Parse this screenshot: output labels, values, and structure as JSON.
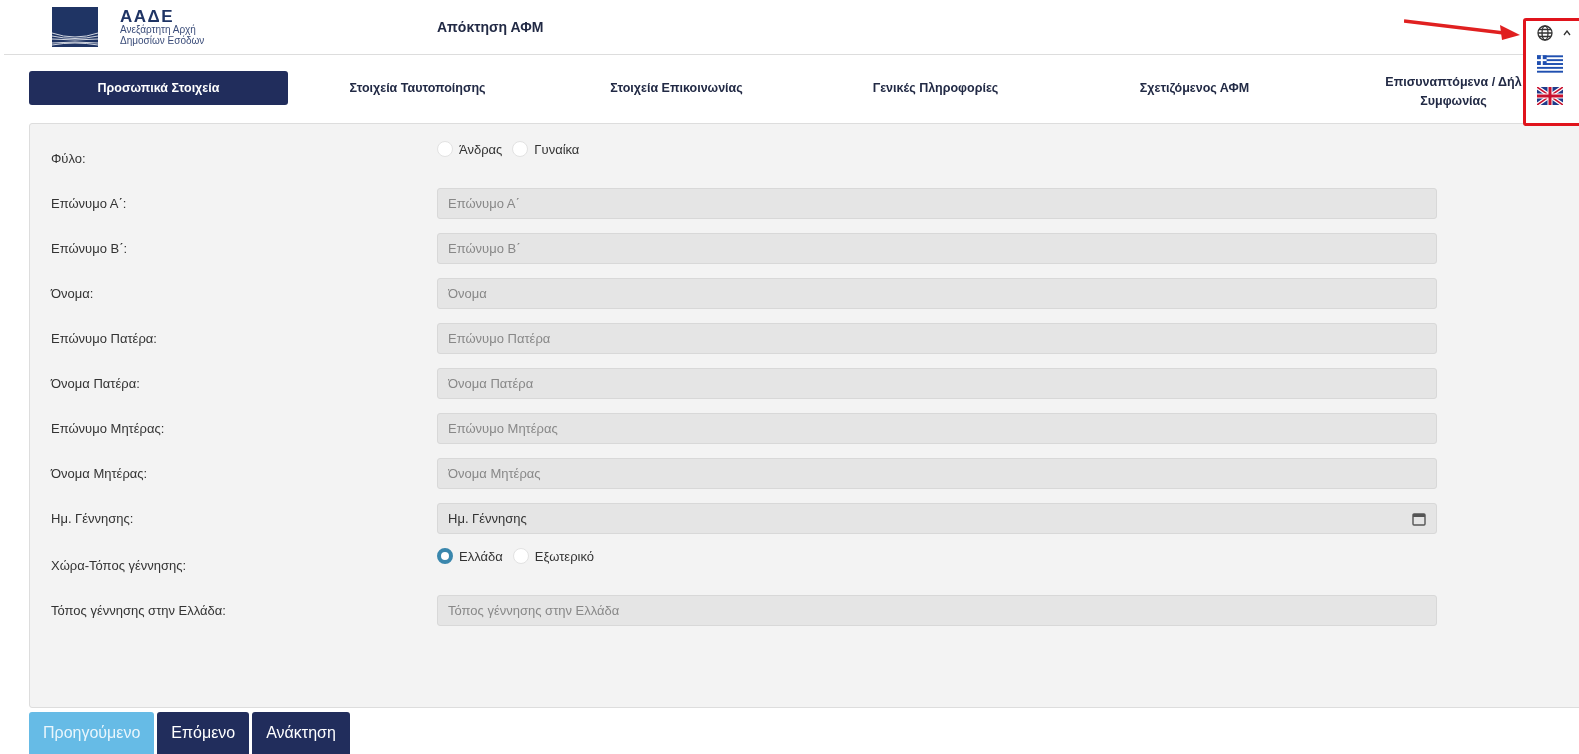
{
  "header": {
    "logo": {
      "acronym": "ΑΑΔΕ",
      "subtitle_line_1": "Ανεξάρτητη Αρχή",
      "subtitle_line_2": "Δημοσίων Εσόδων"
    },
    "title": "Απόκτηση ΑΦΜ"
  },
  "tabs": [
    {
      "label": "Προσωπικά Στοιχεία",
      "selected": true
    },
    {
      "label": "Στοιχεία Ταυτοποίησης",
      "selected": false
    },
    {
      "label": "Στοιχεία Επικοινωνίας",
      "selected": false
    },
    {
      "label": "Γενικές Πληροφορίες",
      "selected": false
    },
    {
      "label": "Σχετιζόμενος ΑΦΜ",
      "selected": false
    },
    {
      "label": "Επισυναπτόμενα / Δήλ Συμφωνίας",
      "selected": false
    }
  ],
  "form": [
    {
      "kind": "radio",
      "label": "Φύλο:",
      "options": [
        {
          "label": "Άνδρας",
          "selected": false
        },
        {
          "label": "Γυναίκα",
          "selected": false
        }
      ]
    },
    {
      "kind": "text",
      "label": "Επώνυμο Α΄:",
      "placeholder": "Επώνυμο Α΄"
    },
    {
      "kind": "text",
      "label": "Επώνυμο Β΄:",
      "placeholder": "Επώνυμο Β΄"
    },
    {
      "kind": "text",
      "label": "Όνομα:",
      "placeholder": "Όνομα"
    },
    {
      "kind": "text",
      "label": "Επώνυμο Πατέρα:",
      "placeholder": "Επώνυμο Πατέρα"
    },
    {
      "kind": "text",
      "label": "Όνομα Πατέρα:",
      "placeholder": "Όνομα Πατέρα"
    },
    {
      "kind": "text",
      "label": "Επώνυμο Μητέρας:",
      "placeholder": "Επώνυμο Μητέρας"
    },
    {
      "kind": "text",
      "label": "Όνομα Μητέρας:",
      "placeholder": "Όνομα Μητέρας"
    },
    {
      "kind": "date",
      "label": "Ημ. Γέννησης:",
      "value": "Ημ. Γέννησης"
    },
    {
      "kind": "radio",
      "label": "Χώρα-Τόπος γέννησης:",
      "options": [
        {
          "label": "Ελλάδα",
          "selected": true
        },
        {
          "label": "Εξωτερικό",
          "selected": false
        }
      ]
    },
    {
      "kind": "text",
      "label": "Τόπος γέννησης στην Ελλάδα:",
      "placeholder": "Τόπος γέννησης στην Ελλάδα"
    }
  ],
  "buttons": [
    {
      "label": "Προηγούμενο",
      "disabled": true
    },
    {
      "label": "Επόμενο",
      "disabled": false
    },
    {
      "label": "Ανάκτηση",
      "disabled": false
    }
  ],
  "language_menu": {
    "expanded": true
  }
}
